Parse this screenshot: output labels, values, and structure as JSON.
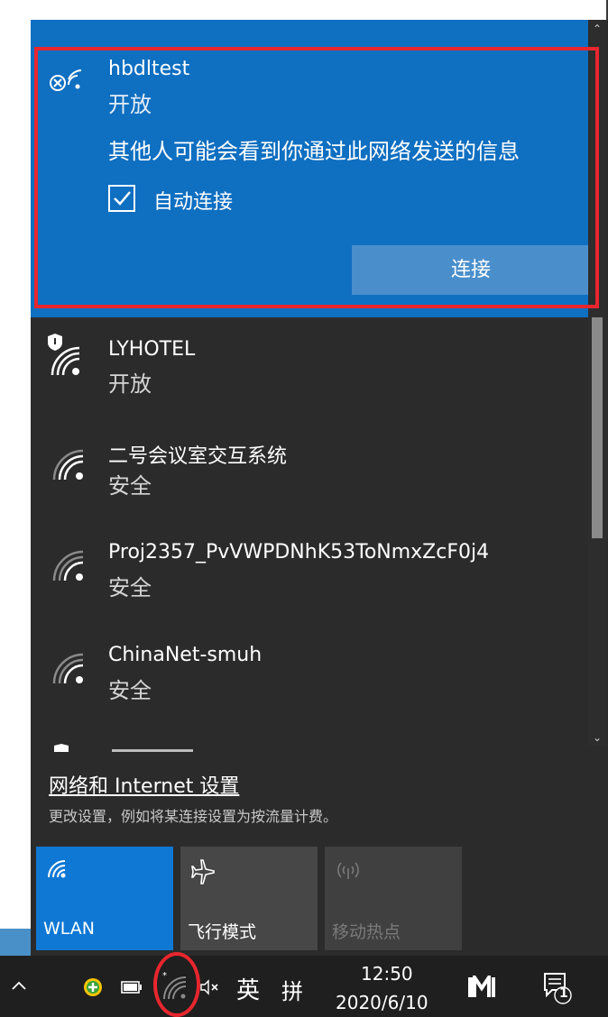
{
  "networks": [
    {
      "name": "hbdltest",
      "status": "开放"
    },
    {
      "name": "LYHOTEL",
      "status": "开放"
    },
    {
      "name": "二号会议室交互系统",
      "status": "安全"
    },
    {
      "name": "Proj2357_PvVWPDNhK53ToNmxZcF0j4",
      "status": "安全"
    },
    {
      "name": "ChinaNet-smuh",
      "status": "安全"
    }
  ],
  "selected": {
    "warning": "其他人可能会看到你通过此网络发送的信息",
    "auto_connect_label": "自动连接",
    "auto_connect_checked": true,
    "connect_label": "连接"
  },
  "settings": {
    "link": "网络和 Internet 设置",
    "description": "更改设置，例如将某连接设置为按流量计费。"
  },
  "quick_actions": [
    {
      "label": "WLAN",
      "active": true,
      "icon": "wifi-icon"
    },
    {
      "label": "飞行模式",
      "active": false,
      "icon": "airplane-icon"
    },
    {
      "label": "移动热点",
      "active": false,
      "disabled": true,
      "icon": "hotspot-icon"
    }
  ],
  "taskbar": {
    "ime_lang": "英",
    "ime_mode": "拼",
    "time": "12:50",
    "date": "2020/6/10",
    "notification_count": "1"
  },
  "colors": {
    "accent": "#0f6fc1",
    "panel": "#2b2b2b",
    "highlight_box": "#e8262e"
  }
}
